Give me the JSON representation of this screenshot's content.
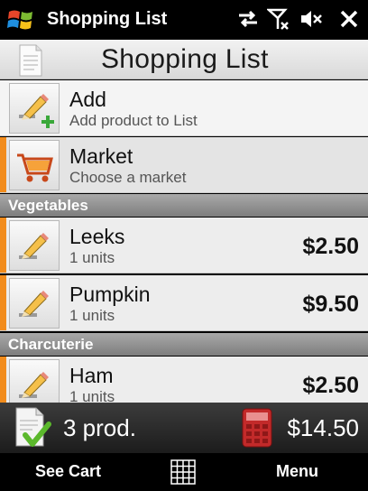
{
  "titlebar": {
    "app_title": "Shopping List",
    "icons": [
      "windows-logo",
      "sync-icon",
      "signal-off-icon",
      "volume-mute-icon",
      "close-icon"
    ]
  },
  "header": {
    "title": "Shopping List",
    "icon": "document-icon"
  },
  "actions": [
    {
      "name": "Add",
      "subtitle": "Add product to List",
      "icon": "pencil-plus-icon"
    },
    {
      "name": "Market",
      "subtitle": "Choose a market",
      "icon": "cart-icon"
    }
  ],
  "sections": [
    {
      "title": "Vegetables",
      "items": [
        {
          "name": "Leeks",
          "qty": "1 units",
          "price": "$2.50"
        },
        {
          "name": "Pumpkin",
          "qty": "1 units",
          "price": "$9.50"
        }
      ]
    },
    {
      "title": "Charcuterie",
      "items": [
        {
          "name": "Ham",
          "qty": "1 units",
          "price": "$2.50"
        }
      ]
    }
  ],
  "summary": {
    "count": "3 prod.",
    "total": "$14.50"
  },
  "softkeys": {
    "left": "See Cart",
    "right": "Menu"
  },
  "colors": {
    "accent": "#f28c1c",
    "section_bar": "#8c8c8c",
    "background": "#000000"
  }
}
